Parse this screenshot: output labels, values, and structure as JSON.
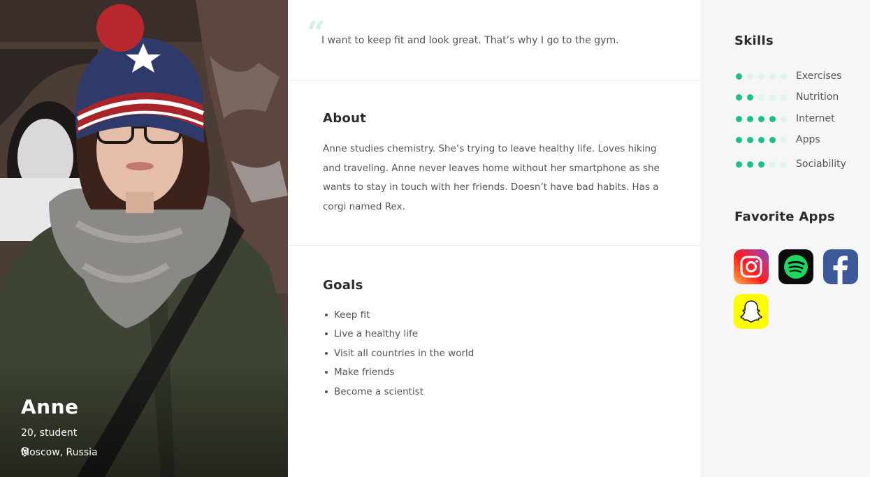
{
  "persona": {
    "name": "Anne",
    "subtitle": "20, student",
    "location": "Moscow, Russia",
    "location_icon": "map-pin-icon",
    "photo_label": "persona-photo"
  },
  "quote": {
    "text": "I want to keep fit and look great. That’s why I go to the gym."
  },
  "about": {
    "title": "About",
    "text": "Anne studies chemistry. She’s trying to leave healthy life. Loves hiking and traveling. Anne never leaves home without her smartphone as she wants to stay in touch with her friends. Doesn’t have bad habits. Has a corgi named Rex."
  },
  "goals": {
    "title": "Goals",
    "items": [
      "Keep fit",
      "Live a healthy life",
      "Visit all countries in the world",
      "Make friends",
      "Become a scientist"
    ]
  },
  "skills": {
    "title": "Skills",
    "max": 5,
    "items": [
      {
        "label": "Exercises",
        "level": 1
      },
      {
        "label": "Nutrition",
        "level": 2
      },
      {
        "label": "Internet",
        "level": 4
      },
      {
        "label": "Apps",
        "level": 4
      },
      {
        "label": "Sociability",
        "level": 3
      }
    ]
  },
  "favorite_apps": {
    "title": "Favorite Apps",
    "items": [
      {
        "name": "instagram-icon"
      },
      {
        "name": "spotify-icon"
      },
      {
        "name": "facebook-icon"
      },
      {
        "name": "snapchat-icon"
      }
    ]
  },
  "colors": {
    "accent": "#1cbf84",
    "accent_light": "#dff4ec",
    "sidebar_bg": "#f6f6f6",
    "text_dark": "#2b2b2b",
    "text_body": "#555555"
  }
}
